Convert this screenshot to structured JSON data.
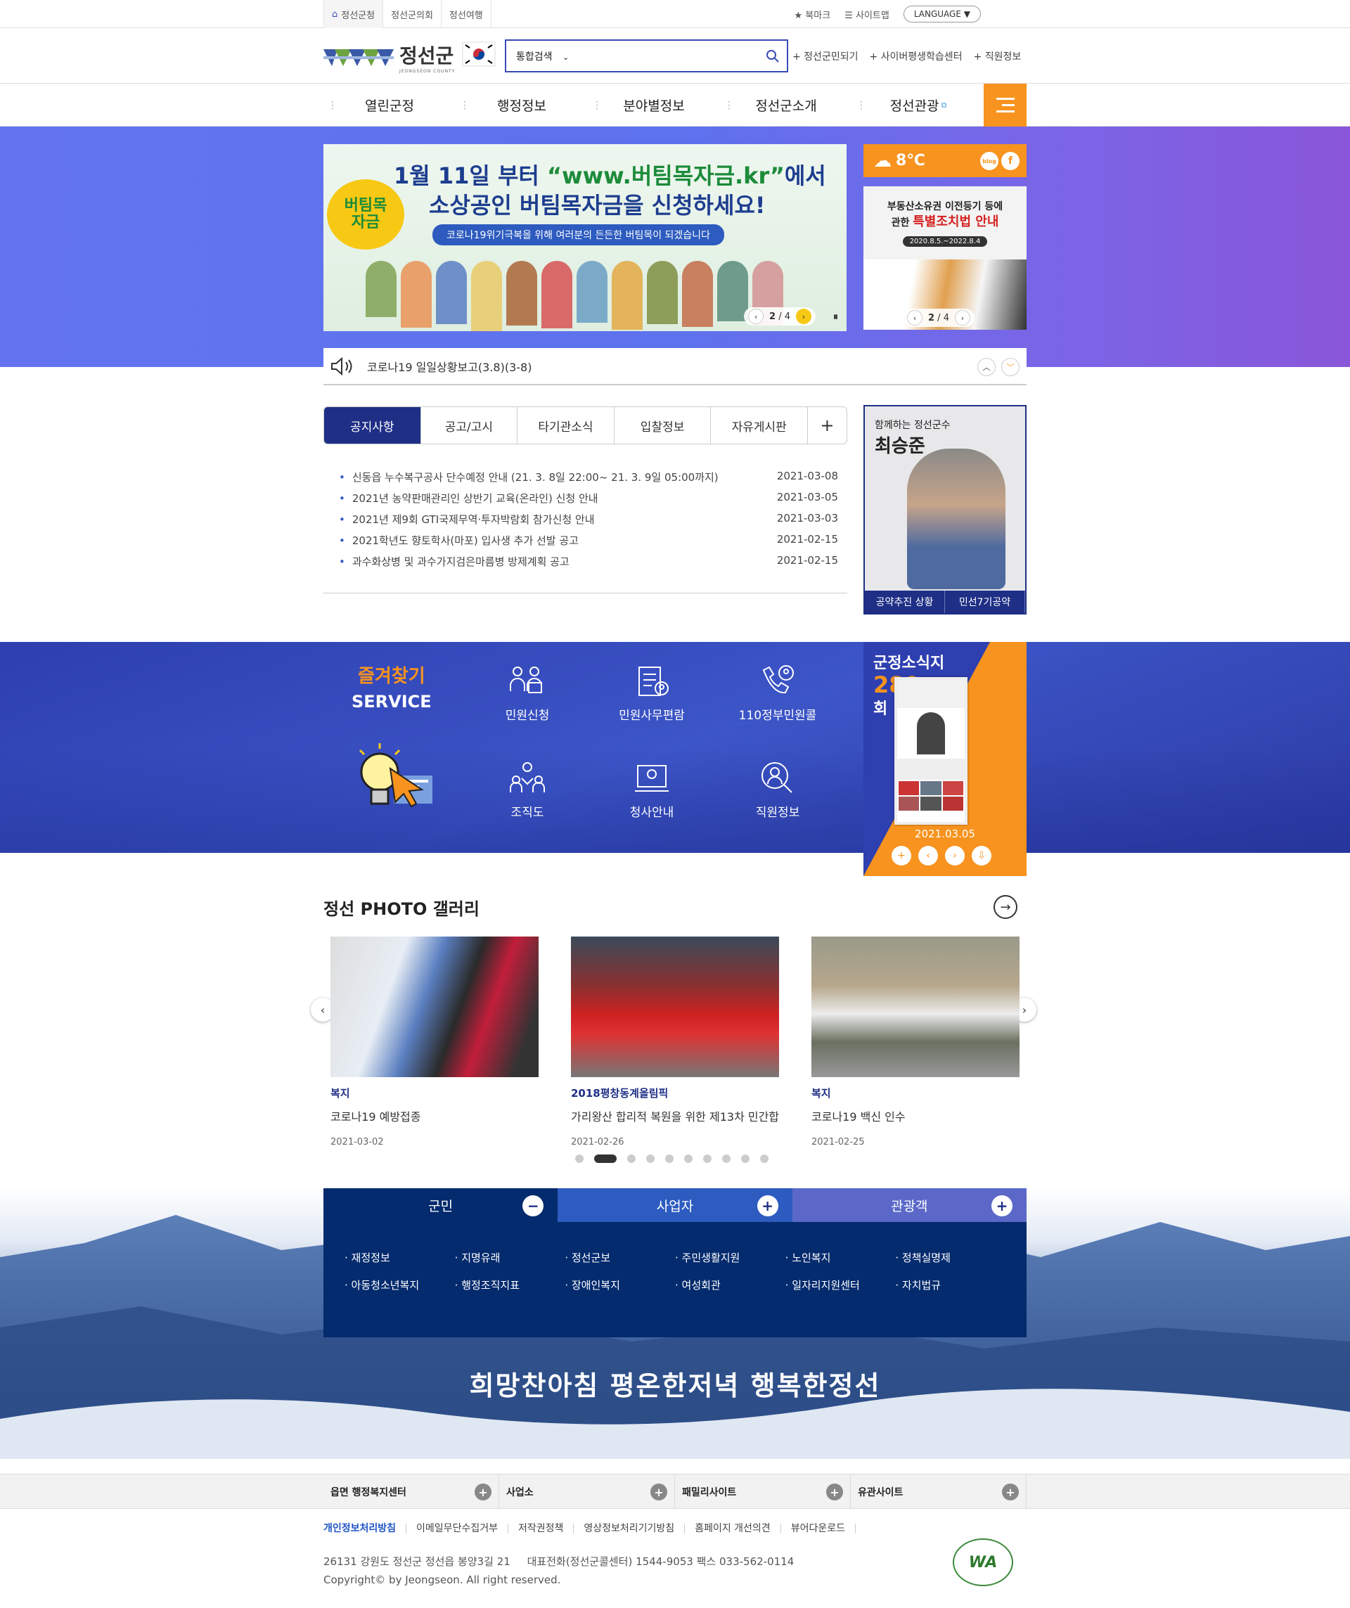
{
  "util": {
    "tabs": [
      "정선군청",
      "정선군의회",
      "정선여행"
    ],
    "bookmark": "북마크",
    "sitemap": "사이트맵",
    "language": "LANGUAGE"
  },
  "header": {
    "logo_text": "정선군",
    "logo_sub": "JEONGSEON COUNTY",
    "search_select": "통합검색",
    "search_placeholder": "",
    "links": [
      "+ 정선군민되기",
      "+ 사이버평생학습센터",
      "+ 직원정보"
    ]
  },
  "gnb": {
    "items": [
      "열린군정",
      "행정정보",
      "분야별정보",
      "정선군소개",
      "정선관광"
    ]
  },
  "main_banner": {
    "line1a": "1월 11일 부터 ",
    "line1b": "“www.버팀목자금.kr”",
    "line1c": "에서",
    "line2": "소상공인 버팀목자금을 신청하세요!",
    "line3": "코로나19위기극복을 위해 여러분의 든든한 버팀목이 되겠습니다",
    "badge": "버팀목\n자금",
    "pager_current": "2",
    "pager_total": "4"
  },
  "weather": {
    "temp": "8℃",
    "sns": [
      "blog",
      "f"
    ]
  },
  "side_banner": {
    "line1": "부동산소유권 이전등기 등에",
    "line2a": "관한 ",
    "line2b": "특별조치법 안내",
    "period": "2020.8.5.~2022.8.4",
    "pager_current": "2",
    "pager_total": "4"
  },
  "ticker": {
    "text": "코로나19 일일상황보고(3.8)(3-8)"
  },
  "board": {
    "tabs": [
      "공지사항",
      "공고/고시",
      "타기관소식",
      "입찰정보",
      "자유게시판",
      "+"
    ],
    "items": [
      {
        "title": "신동읍 누수복구공사 단수예정 안내 (21. 3. 8일 22:00~ 21. 3. 9일 05:00까지)",
        "date": "2021-03-08"
      },
      {
        "title": "2021년 농약판매관리인 상반기 교육(온라인) 신청 안내",
        "date": "2021-03-05"
      },
      {
        "title": "2021년 제9회 GTI국제무역·투자박람회 참가신청 안내",
        "date": "2021-03-03"
      },
      {
        "title": "2021학년도 향토학사(마포) 입사생 추가 선발 공고",
        "date": "2021-02-15"
      },
      {
        "title": "과수화상병 및 과수가지검은마름병 방제계획 공고",
        "date": "2021-02-15"
      }
    ]
  },
  "mayor": {
    "subtitle": "함께하는 정선군수",
    "name": "최승준",
    "links": [
      "공약추진 상황",
      "민선7기공약"
    ]
  },
  "service": {
    "title1": "즐겨찾기",
    "title2": "SERVICE",
    "items": [
      "민원신청",
      "민원사무편람",
      "110정부민원콜",
      "조직도",
      "청사안내",
      "직원정보"
    ]
  },
  "magazine": {
    "title": "군정소식지",
    "issue": "289",
    "unit": "회",
    "date": "2021.03.05"
  },
  "gallery": {
    "title": "정선 PHOTO 갤러리",
    "items": [
      {
        "cat": "복지",
        "title": "코로나19 예방접종",
        "date": "2021-03-02"
      },
      {
        "cat": "2018평창동계올림픽",
        "title": "가리왕산 합리적 복원을 위한 제13차 민간합",
        "date": "2021-02-26"
      },
      {
        "cat": "복지",
        "title": "코로나19 백신 인수",
        "date": "2021-02-25"
      }
    ]
  },
  "citizen": {
    "tabs": [
      "군민",
      "사업자",
      "관광객"
    ],
    "links": [
      "재정정보",
      "지명유래",
      "정선군보",
      "주민생활지원",
      "노인복지",
      "정책실명제",
      "아동청소년복지",
      "행정조직지표",
      "장애인복지",
      "여성회관",
      "일자리지원센터",
      "자치법규"
    ]
  },
  "slogan": "희망찬아침 평온한저녁 행복한정선",
  "footer": {
    "bar": [
      "읍면 행정복지센터",
      "사업소",
      "패밀리사이트",
      "유관사이트"
    ],
    "links": [
      "개인정보처리방침",
      "이메일무단수집거부",
      "저작권정책",
      "영상정보처리기기방침",
      "홈페이지 개선의견",
      "뷰어다운로드"
    ],
    "address": "26131 강원도 정선군 정선읍 봉양3길 21     대표전화(정선군콜센터) 1544-9053 팩스 033-562-0114",
    "copyright": "Copyright© by Jeongseon. All right reserved.",
    "wa": "WA"
  }
}
